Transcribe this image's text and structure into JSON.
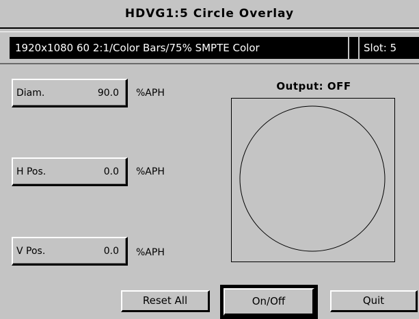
{
  "window": {
    "title": "HDVG1:5  Circle Overlay"
  },
  "status": {
    "format": "1920x1080  60 2:1/Color Bars/75% SMPTE  Color",
    "slot": "Slot: 5"
  },
  "params": {
    "diameter": {
      "label": "Diam.",
      "value": "90.0",
      "unit": "%APH"
    },
    "hpos": {
      "label": "H Pos.",
      "value": "0.0",
      "unit": "%APH"
    },
    "vpos": {
      "label": "V Pos.",
      "value": "0.0",
      "unit": "%APH"
    }
  },
  "output": {
    "label": "Output: OFF"
  },
  "buttons": {
    "reset_all": "Reset All",
    "on_off": "On/Off",
    "quit": "Quit"
  }
}
